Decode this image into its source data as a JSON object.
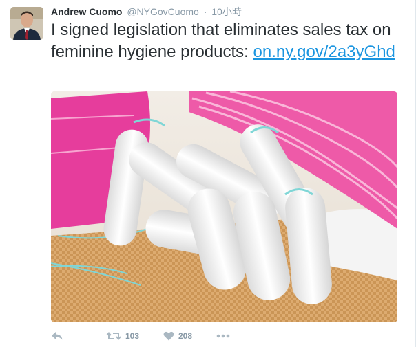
{
  "tweet": {
    "author": {
      "name": "Andrew Cuomo",
      "handle": "@NYGovCuomo",
      "avatar_icon": "profile-photo"
    },
    "separator": "·",
    "timestamp": "10小時",
    "text": "I signed legislation that eliminates sales tax on feminine hygiene products:",
    "link": "on.ny.gov/2a3yGhd",
    "photo": {
      "icon": "photo-tampons-and-pads"
    },
    "actions": {
      "reply_icon": "reply-icon",
      "retweet_icon": "retweet-icon",
      "retweet_count": "103",
      "like_icon": "heart-icon",
      "like_count": "208",
      "more_icon": "more-icon"
    }
  },
  "colors": {
    "link": "#1b95e0",
    "meta": "#8899a6",
    "text": "#292f33",
    "pad_pink": "#e8459a",
    "tampon_string": "#7fd6d6"
  }
}
